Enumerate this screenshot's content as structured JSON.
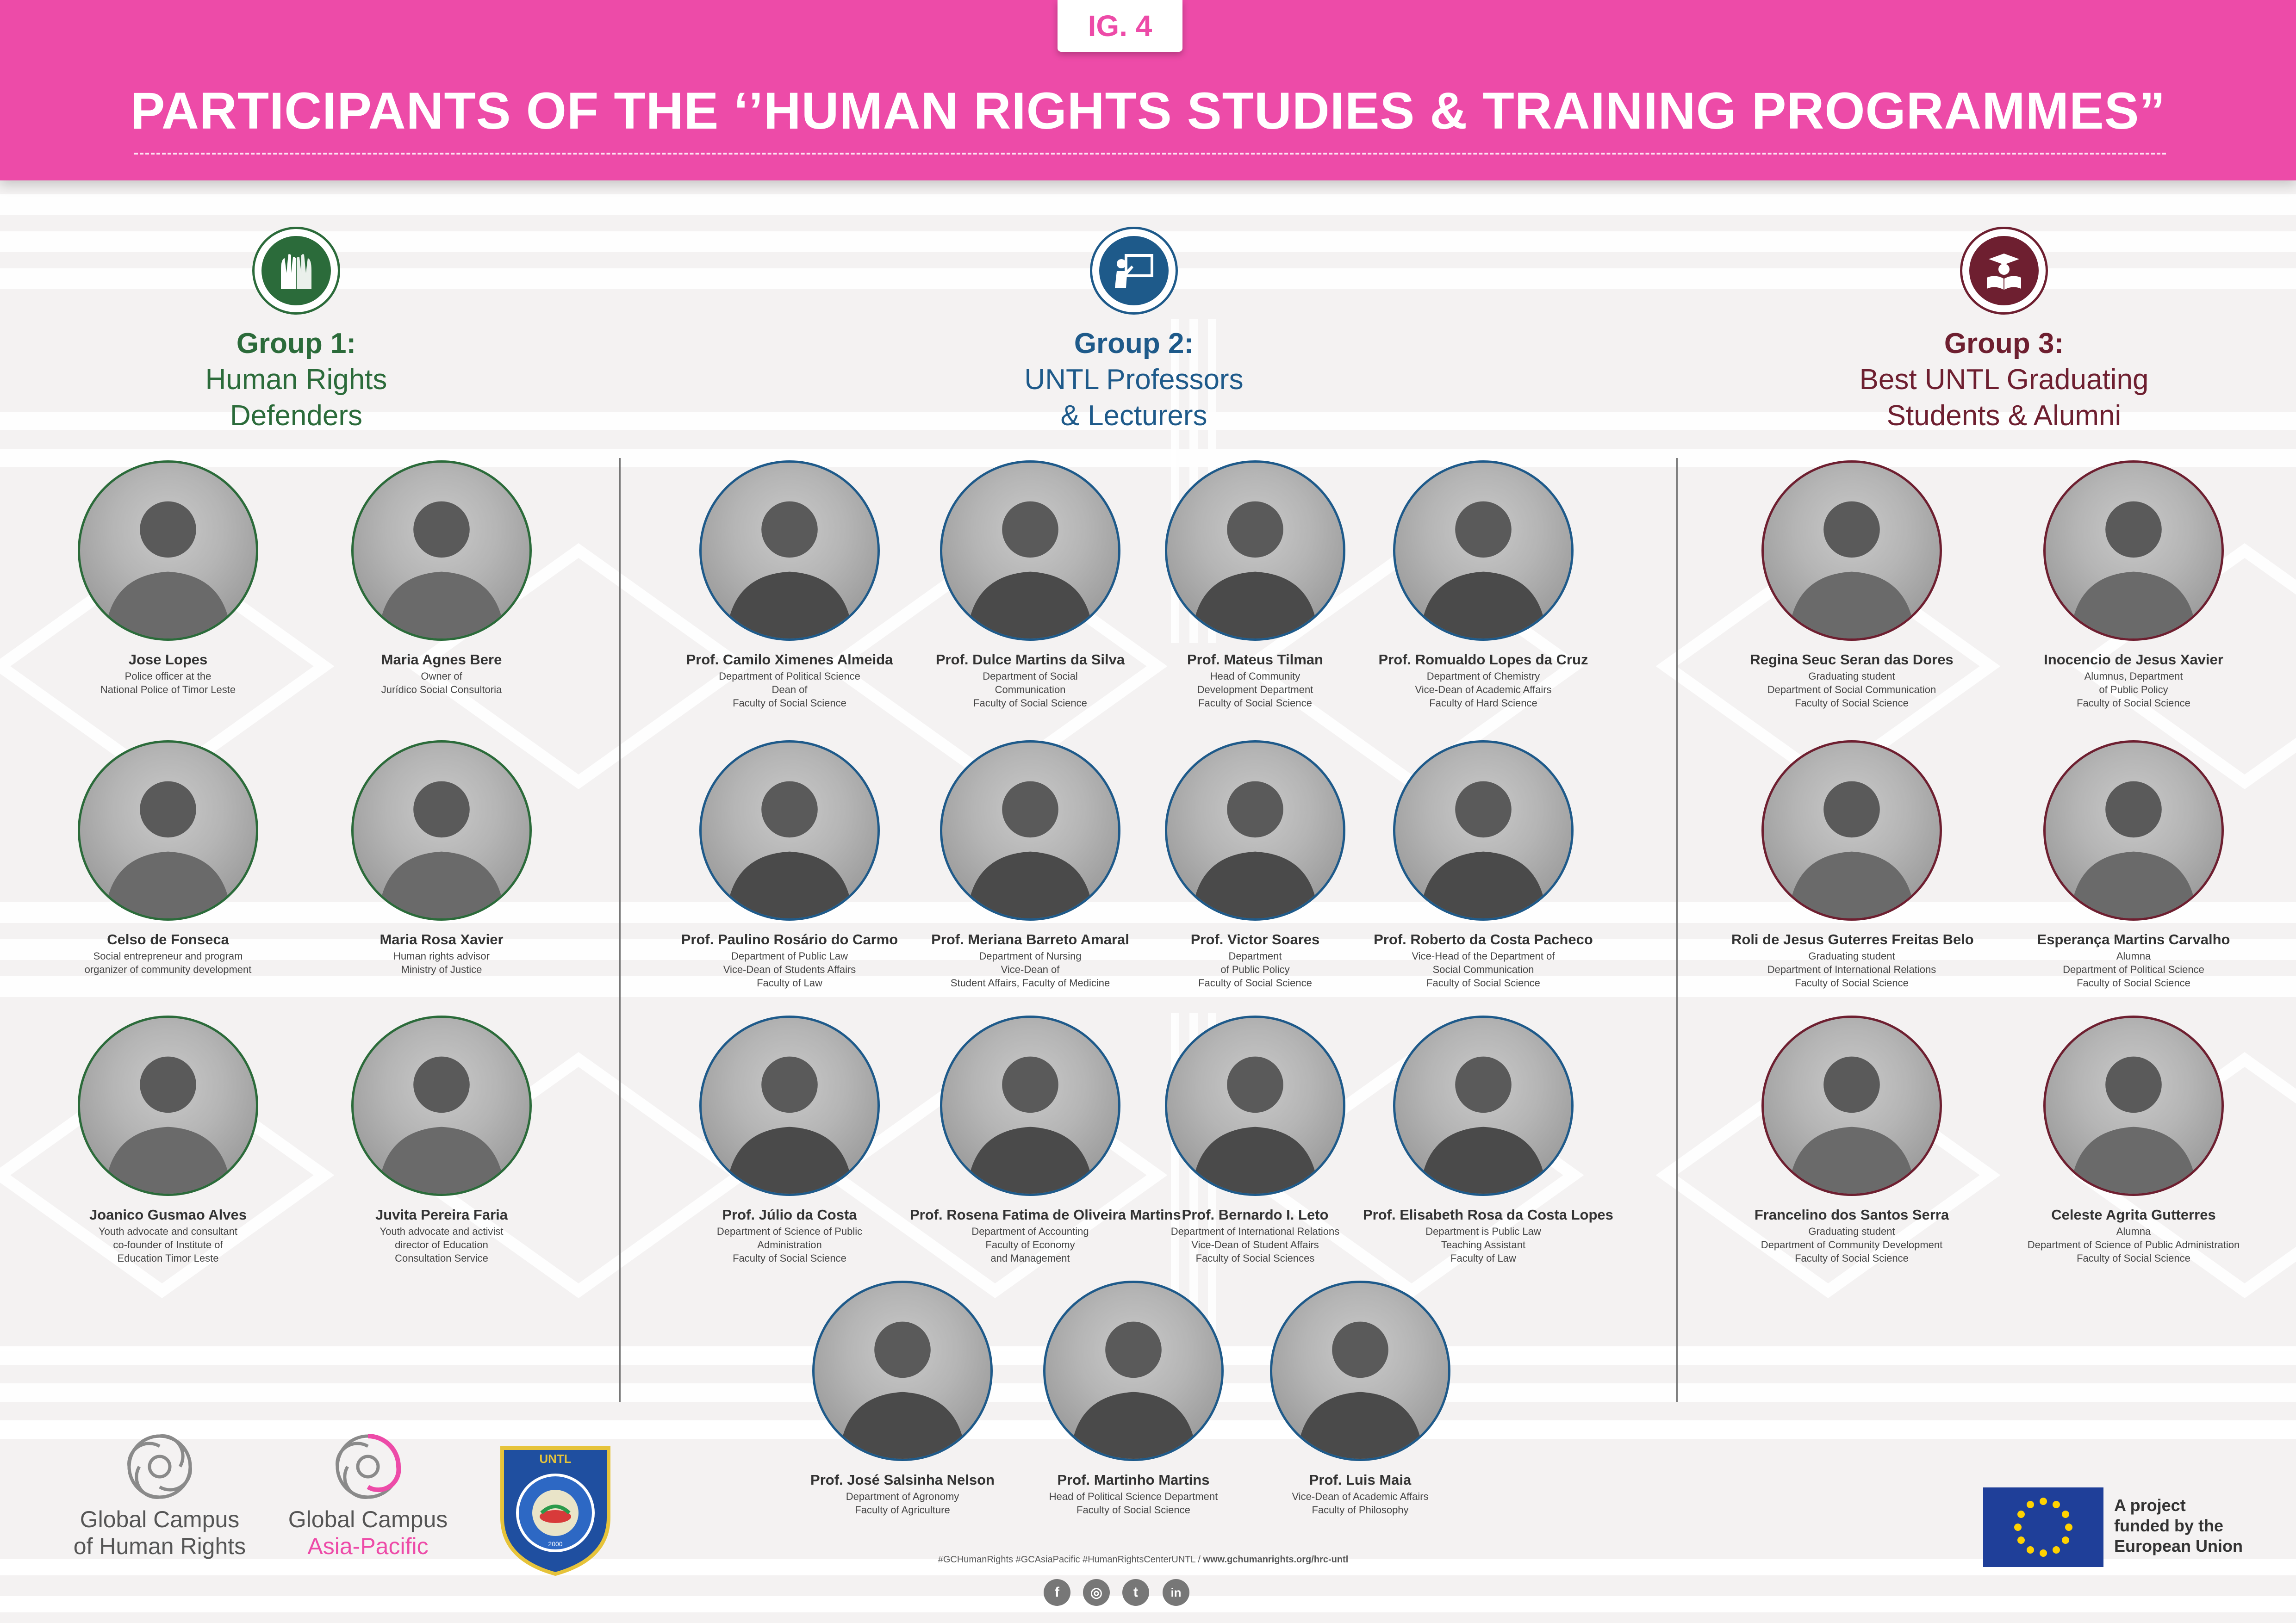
{
  "header": {
    "fig_label": "IG. 4",
    "title": "PARTICIPANTS OF THE ‘’HUMAN RIGHTS STUDIES & TRAINING PROGRAMMES”"
  },
  "colors": {
    "brand_pink": "#ed4ba8",
    "group1": "#2b6b3a",
    "group2": "#1e5a8a",
    "group3": "#6e1f30"
  },
  "groups": [
    {
      "title": "Group 1:",
      "subtitle_1": "Human Rights",
      "subtitle_2": "Defenders",
      "icon": "raised-hands-icon"
    },
    {
      "title": "Group 2:",
      "subtitle_1": "UNTL Professors",
      "subtitle_2": "& Lecturers",
      "icon": "teacher-board-icon"
    },
    {
      "title": "Group 3:",
      "subtitle_1": "Best UNTL Graduating",
      "subtitle_2": "Students & Alumni",
      "icon": "graduate-book-icon"
    }
  ],
  "group1_people": [
    {
      "name": "Jose Lopes",
      "role": "Police officer at the\nNational Police of Timor Leste"
    },
    {
      "name": "Maria Agnes Bere",
      "role": "Owner of\nJurídico Social Consultoria"
    },
    {
      "name": "Celso de Fonseca",
      "role": "Social entrepreneur and program\norganizer of community development"
    },
    {
      "name": "Maria Rosa Xavier",
      "role": "Human rights advisor\nMinistry of Justice"
    },
    {
      "name": "Joanico Gusmao Alves",
      "role": "Youth advocate and consultant\nco-founder of Institute of\nEducation Timor Leste"
    },
    {
      "name": "Juvita Pereira Faria",
      "role": "Youth advocate and activist\ndirector of Education\nConsultation Service"
    }
  ],
  "group2_people": [
    {
      "name": "Prof. Camilo Ximenes Almeida",
      "role": "Department of Political Science\nDean of\nFaculty of Social Science"
    },
    {
      "name": "Prof. Dulce Martins da Silva",
      "role": "Department of Social\nCommunication\nFaculty of Social Science"
    },
    {
      "name": "Prof. Mateus Tilman",
      "role": "Head of Community\nDevelopment Department\nFaculty of Social Science"
    },
    {
      "name": "Prof. Romualdo Lopes da Cruz",
      "role": "Department of Chemistry\nVice-Dean of Academic Affairs\nFaculty of Hard Science"
    },
    {
      "name": "Prof. Paulino Rosário do Carmo",
      "role": "Department of Public Law\nVice-Dean of Students Affairs\nFaculty of Law"
    },
    {
      "name": "Prof. Meriana Barreto Amaral",
      "role": "Department of Nursing\nVice-Dean of\nStudent Affairs, Faculty of Medicine"
    },
    {
      "name": "Prof. Victor Soares",
      "role": "Department\nof Public Policy\nFaculty of Social Science"
    },
    {
      "name": "Prof. Roberto da Costa Pacheco",
      "role": "Vice-Head of the Department of\nSocial Communication\nFaculty of Social Science"
    },
    {
      "name": "Prof. Júlio da Costa",
      "role": "Department of Science of Public\nAdministration\nFaculty of Social Science"
    },
    {
      "name": "Prof. Rosena Fatima de Oliveira Martins",
      "role": "Department of Accounting\nFaculty of Economy\nand Management"
    },
    {
      "name": "Prof. Bernardo I. Leto",
      "role": "Department of International Relations\nVice-Dean of Student Affairs\nFaculty of Social Sciences"
    },
    {
      "name": "Prof. Elisabeth Rosa da Costa Lopes",
      "role": "Department is Public Law\nTeaching Assistant\nFaculty of Law"
    },
    {
      "name": "Prof. José Salsinha Nelson",
      "role": "Department of Agronomy\nFaculty of Agriculture"
    },
    {
      "name": "Prof. Martinho Martins",
      "role": "Head of Political Science Department\nFaculty of Social Science"
    },
    {
      "name": "Prof. Luis Maia",
      "role": "Vice-Dean of Academic Affairs\nFaculty of Philosophy"
    }
  ],
  "group3_people": [
    {
      "name": "Regina Seuc Seran das Dores",
      "role": "Graduating student\nDepartment of Social Communication\nFaculty of Social Science"
    },
    {
      "name": "Inocencio de Jesus Xavier",
      "role": "Alumnus, Department\nof Public Policy\nFaculty of Social Science"
    },
    {
      "name": "Roli de Jesus Guterres Freitas Belo",
      "role": "Graduating student\nDepartment of International Relations\nFaculty of Social Science"
    },
    {
      "name": "Esperança Martins Carvalho",
      "role": "Alumna\nDepartment of Political Science\nFaculty of Social Science"
    },
    {
      "name": "Francelino dos Santos Serra",
      "role": "Graduating student\nDepartment of Community Development\nFaculty of Social Science"
    },
    {
      "name": "Celeste Agrita Gutterres",
      "role": "Alumna\nDepartment of Science of Public Administration\nFaculty of Social Science"
    }
  ],
  "footer": {
    "logo1_line1": "Global Campus",
    "logo1_line2": "of Human Rights",
    "logo2_line1": "Global Campus",
    "logo2_line2": "Asia-Pacific",
    "untl_top": "UNTL",
    "untl_ring": "UNIVERSIDADE NACIONAL TIMOR LOROSA'E",
    "untl_year": "2000",
    "hashtags": "#GCHumanRights #GCAsiaPacific #HumanRightsCenterUNTL / ",
    "website": "www.gchumanrights.org/hrc-untl",
    "eu_line1": "A project",
    "eu_line2": "funded by the",
    "eu_line3": "European Union",
    "social": [
      "f",
      "◎",
      "t",
      "in"
    ]
  }
}
